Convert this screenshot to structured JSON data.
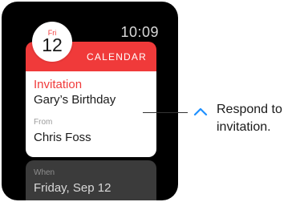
{
  "watch": {
    "time": "10:09",
    "header": {
      "day": "Fri",
      "date": "12",
      "app_name": "CALENDAR"
    },
    "card": {
      "label": "Invitation",
      "title": "Gary’s Birthday",
      "from_label": "From",
      "from_name": "Chris Foss"
    },
    "next": {
      "when_label": "When",
      "when_value": "Friday, Sep 12"
    }
  },
  "callout": {
    "icon": "chevron-up-icon",
    "text": "Respond to invitation."
  },
  "colors": {
    "accent": "#f03a3a",
    "callout_icon": "#1e90ff",
    "watch_bg": "#000000"
  }
}
